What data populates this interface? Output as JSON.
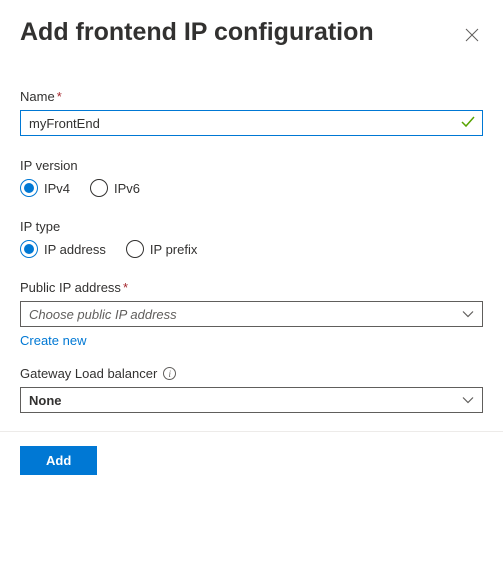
{
  "title": "Add frontend IP configuration",
  "name": {
    "label": "Name",
    "required": "*",
    "value": "myFrontEnd"
  },
  "ip_version": {
    "label": "IP version",
    "options": [
      {
        "label": "IPv4",
        "checked": true
      },
      {
        "label": "IPv6",
        "checked": false
      }
    ]
  },
  "ip_type": {
    "label": "IP type",
    "options": [
      {
        "label": "IP address",
        "checked": true
      },
      {
        "label": "IP prefix",
        "checked": false
      }
    ]
  },
  "public_ip": {
    "label": "Public IP address",
    "required": "*",
    "placeholder": "Choose public IP address",
    "create_new": "Create new"
  },
  "gateway": {
    "label": "Gateway Load balancer",
    "value": "None"
  },
  "add_button": "Add"
}
